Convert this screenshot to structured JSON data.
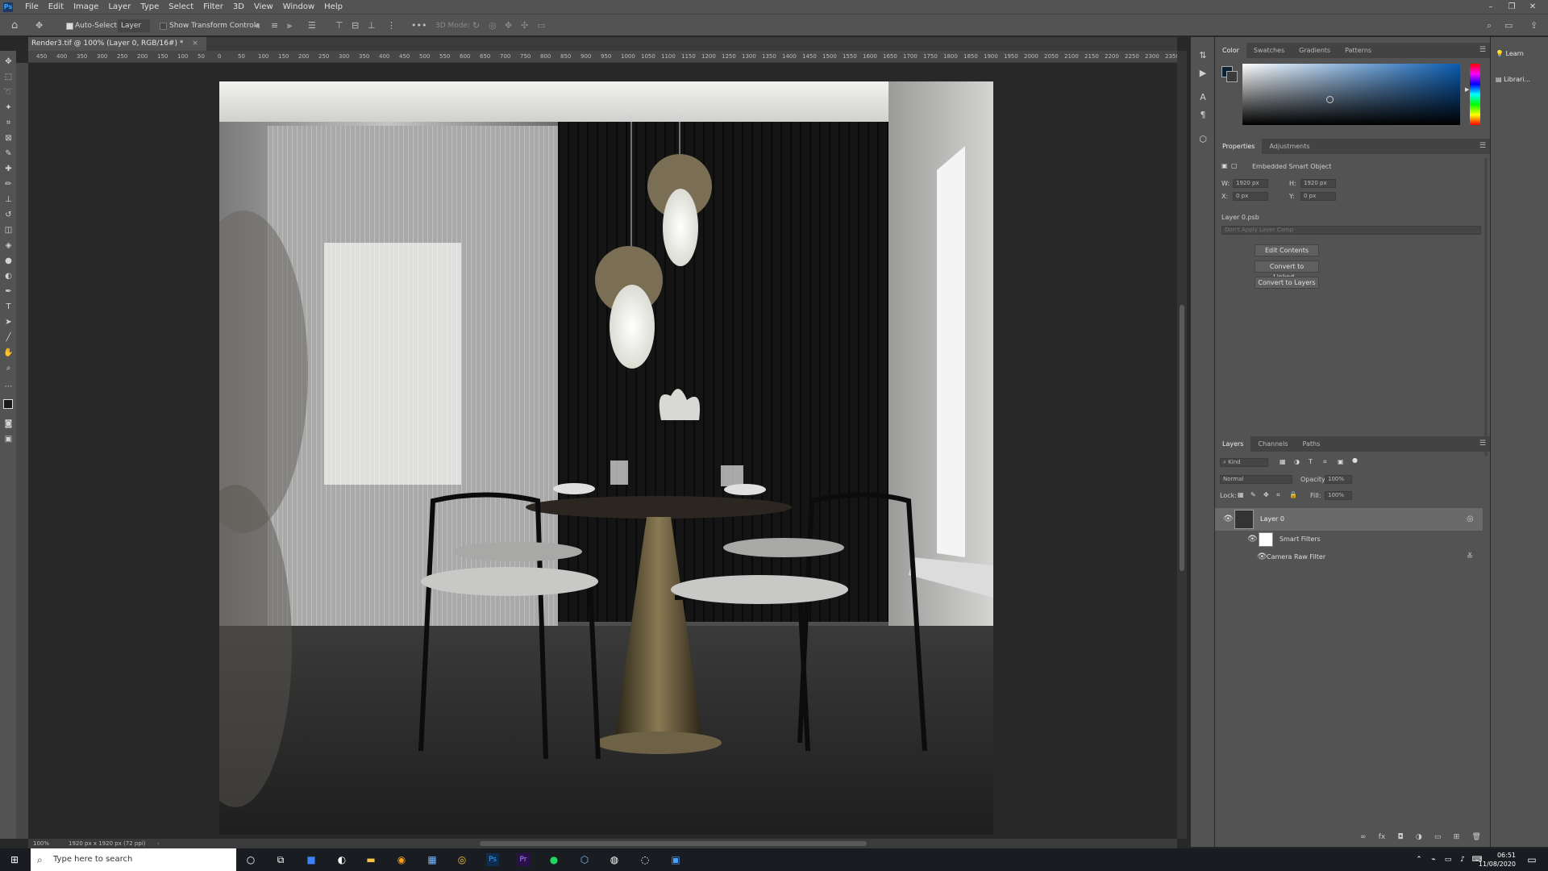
{
  "app": {
    "logo": "Ps",
    "menu": [
      "File",
      "Edit",
      "Image",
      "Layer",
      "Type",
      "Select",
      "Filter",
      "3D",
      "View",
      "Window",
      "Help"
    ],
    "window_controls": [
      "–",
      "❐",
      "✕"
    ]
  },
  "options_bar": {
    "home_icon": "home-icon",
    "auto_select_label": "Auto-Select:",
    "auto_select_value": "Layer",
    "show_transform_label": "Show Transform Controls",
    "mode_3d_label": "3D Mode:"
  },
  "document": {
    "tab_title": "Render3.tif @ 100% (Layer 0, RGB/16#) *",
    "zoom": "100%",
    "status_info": "1920 px x 1920 px (72 ppi)",
    "ruler_ticks": [
      "450",
      "400",
      "350",
      "300",
      "250",
      "200",
      "150",
      "100",
      "50",
      "0",
      "50",
      "100",
      "150",
      "200",
      "250",
      "300",
      "350",
      "400",
      "450",
      "500",
      "550",
      "600",
      "650",
      "700",
      "750",
      "800",
      "850",
      "900",
      "950",
      "1000",
      "1050",
      "1100",
      "1150",
      "1200",
      "1250",
      "1300",
      "1350",
      "1400",
      "1450",
      "1500",
      "1550",
      "1600",
      "1650",
      "1700",
      "1750",
      "1800",
      "1850",
      "1900",
      "1950",
      "2000",
      "2050",
      "2100",
      "2150",
      "2200",
      "2250",
      "2300",
      "2350"
    ]
  },
  "color_panel": {
    "tabs": [
      "Color",
      "Swatches",
      "Gradients",
      "Patterns"
    ],
    "active_tab": "Color",
    "hue_color": "#0a5cb0"
  },
  "properties_panel": {
    "tabs": [
      "Properties",
      "Adjustments"
    ],
    "active_tab": "Properties",
    "object_type": "Embedded Smart Object",
    "w_label": "W:",
    "w_value": "1920 px",
    "h_label": "H:",
    "h_value": "1920 px",
    "x_label": "X:",
    "x_value": "0 px",
    "y_label": "Y:",
    "y_value": "0 px",
    "file_name": "Layer 0.psb",
    "layer_comp_placeholder": "Don't Apply Layer Comp",
    "buttons": [
      "Edit Contents",
      "Convert to Linked...",
      "Convert to Layers"
    ]
  },
  "layers_panel": {
    "tabs": [
      "Layers",
      "Channels",
      "Paths"
    ],
    "active_tab": "Layers",
    "filter_kind": "Kind",
    "blend_mode": "Normal",
    "opacity_label": "Opacity:",
    "opacity_value": "100%",
    "lock_label": "Lock:",
    "fill_label": "Fill:",
    "fill_value": "100%",
    "layers": [
      {
        "name": "Layer 0"
      },
      {
        "name": "Smart Filters"
      },
      {
        "name": "Camera Raw Filter"
      }
    ]
  },
  "learn_panel": {
    "items": [
      "Learn",
      "Librari..."
    ]
  },
  "taskbar": {
    "search_placeholder": "Type here to search",
    "time": "06:51",
    "date": "11/08/2020"
  }
}
